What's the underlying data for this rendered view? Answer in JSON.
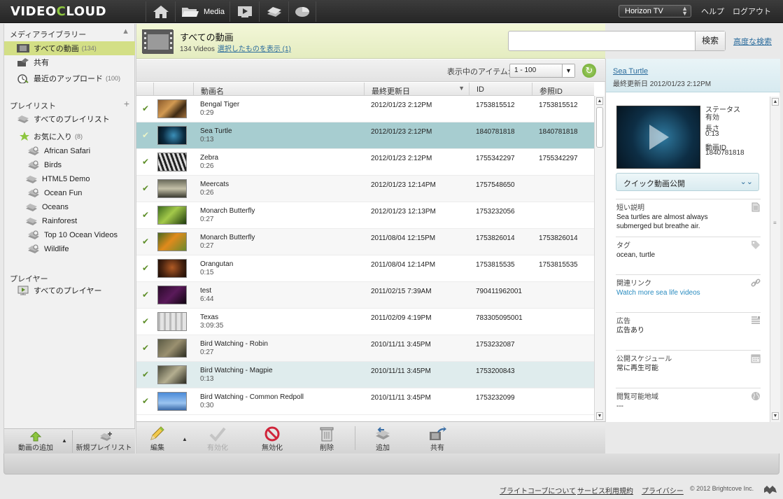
{
  "app": {
    "logo_video": "VIDEO",
    "logo_c": "C",
    "logo_loud": "LOUD",
    "media_label": "Media",
    "account": "Horizon TV",
    "help": "ヘルプ",
    "logout": "ログアウト"
  },
  "sidebar": {
    "library_header": "メディアライブラリー",
    "library_items": [
      {
        "label": "すべての動画",
        "count": "(134)"
      },
      {
        "label": "共有",
        "count": ""
      },
      {
        "label": "最近のアップロード",
        "count": "(100)"
      }
    ],
    "playlist_header": "プレイリスト",
    "all_playlists": "すべてのプレイリスト",
    "favorites": {
      "label": "お気に入り",
      "count": "(8)"
    },
    "playlists": [
      "African Safari",
      "Birds",
      "HTML5 Demo",
      "Ocean Fun",
      "Oceans",
      "Rainforest",
      "Top 10 Ocean Videos",
      "Wildlife"
    ],
    "player_header": "プレイヤー",
    "all_players": "すべてのプレイヤー",
    "add_video": "動画の追加",
    "new_playlist": "新規プレイリスト"
  },
  "main": {
    "title": "すべての動画",
    "count_text": "134 Videos",
    "show_selected": "選択したものを表示 (1)",
    "search_placeholder": "",
    "search_button": "検索",
    "advanced_search": "高度な検索",
    "showing_label": "表示中のアイテム:",
    "range": "1 - 100",
    "columns": {
      "name": "動画名",
      "updated": "最終更新日",
      "id": "ID",
      "ref": "参照ID"
    },
    "rows": [
      {
        "name": "Bengal Tiger",
        "duration": "0:29",
        "updated": "2012/01/23 2:12PM",
        "id": "1753815512",
        "ref": "1753815512"
      },
      {
        "name": "Sea Turtle",
        "duration": "0:13",
        "updated": "2012/01/23 2:12PM",
        "id": "1840781818",
        "ref": "1840781818"
      },
      {
        "name": "Zebra",
        "duration": "0:26",
        "updated": "2012/01/23 2:12PM",
        "id": "1755342297",
        "ref": "1755342297"
      },
      {
        "name": "Meercats",
        "duration": "0:26",
        "updated": "2012/01/23 12:14PM",
        "id": "1757548650",
        "ref": ""
      },
      {
        "name": "Monarch Butterfly",
        "duration": "0:27",
        "updated": "2012/01/23 12:13PM",
        "id": "1753232056",
        "ref": ""
      },
      {
        "name": "Monarch Butterfly",
        "duration": "0:27",
        "updated": "2011/08/04 12:15PM",
        "id": "1753826014",
        "ref": "1753826014"
      },
      {
        "name": "Orangutan",
        "duration": "0:15",
        "updated": "2011/08/04 12:14PM",
        "id": "1753815535",
        "ref": "1753815535"
      },
      {
        "name": "test",
        "duration": "6:44",
        "updated": "2011/02/15 7:39AM",
        "id": "790411962001",
        "ref": ""
      },
      {
        "name": "Texas",
        "duration": "3:09:35",
        "updated": "2011/02/09 4:19PM",
        "id": "783305095001",
        "ref": ""
      },
      {
        "name": "Bird Watching - Robin",
        "duration": "0:27",
        "updated": "2010/11/11 3:45PM",
        "id": "1753232087",
        "ref": ""
      },
      {
        "name": "Bird Watching - Magpie",
        "duration": "0:13",
        "updated": "2010/11/11 3:45PM",
        "id": "1753200843",
        "ref": ""
      },
      {
        "name": "Bird Watching - Common Redpoll",
        "duration": "0:30",
        "updated": "2010/11/11 3:45PM",
        "id": "1753232099",
        "ref": ""
      }
    ],
    "actions": {
      "edit": "編集",
      "activate": "有効化",
      "deactivate": "無効化",
      "delete": "削除",
      "add": "追加",
      "share": "共有"
    }
  },
  "detail": {
    "name": "Sea Turtle",
    "updated": "最終更新日 2012/01/23 2:12PM",
    "status_label": "ステータス",
    "status_value": "有効",
    "length_label": "長さ",
    "length_value": "0:13",
    "video_id_label": "動画ID",
    "video_id_value": "1840781818",
    "quick_publish": "クイック動画公開",
    "fields": [
      {
        "label": "短い説明",
        "value": "Sea turtles are almost always submerged but breathe air.",
        "icon": "document-icon"
      },
      {
        "label": "タグ",
        "value": "ocean, turtle",
        "icon": "tag-icon"
      },
      {
        "label": "関連リンク",
        "value": "Watch more sea life videos",
        "icon": "link-icon"
      },
      {
        "label": "広告",
        "value": "広告あり",
        "icon": "ad-list-icon"
      },
      {
        "label": "公開スケジュール",
        "value": "常に再生可能",
        "icon": "calendar-icon"
      },
      {
        "label": "閲覧可能地域",
        "value": "---",
        "icon": "globe-icon"
      }
    ]
  },
  "footer": {
    "about": "ブライトコーブについて",
    "terms": "サービス利用規約",
    "privacy": "プライバシー",
    "copyright": "© 2012 Brightcove Inc."
  },
  "colors": {
    "accent_green": "#8dc63f",
    "selected_row": "#a7cdd0",
    "sidebar_selected": "#d3df86"
  }
}
